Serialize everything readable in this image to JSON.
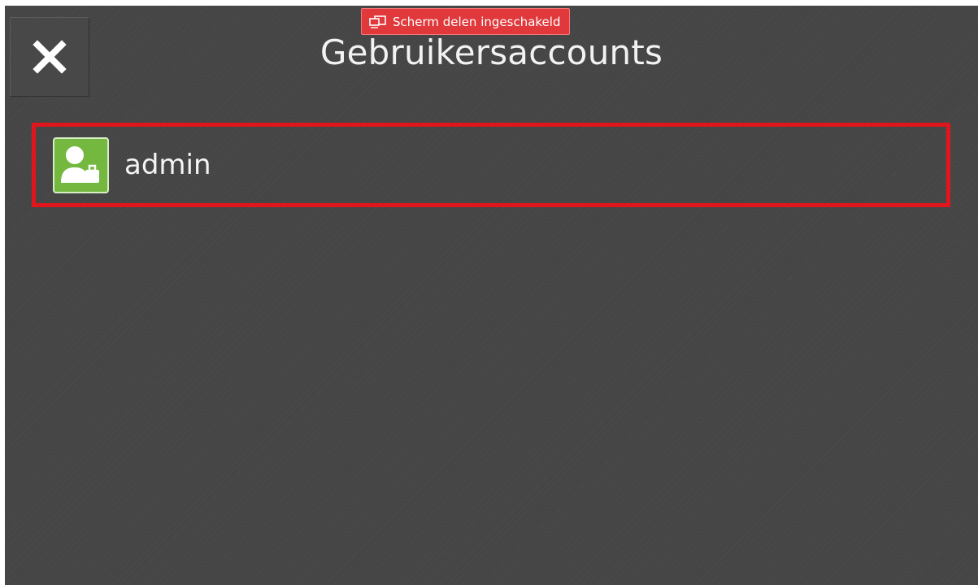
{
  "header": {
    "title": "Gebruikersaccounts",
    "close_icon": "close-icon"
  },
  "status_badge": {
    "icon": "screen-share-icon",
    "label": "Scherm delen ingeschakeld",
    "color": "#e0383b"
  },
  "accounts": {
    "items": [
      {
        "icon": "user-avatar-icon",
        "name": "admin",
        "selected": true
      }
    ]
  },
  "colors": {
    "background": "#474747",
    "selection_border": "#e0161c",
    "avatar_green": "#74b83f"
  }
}
